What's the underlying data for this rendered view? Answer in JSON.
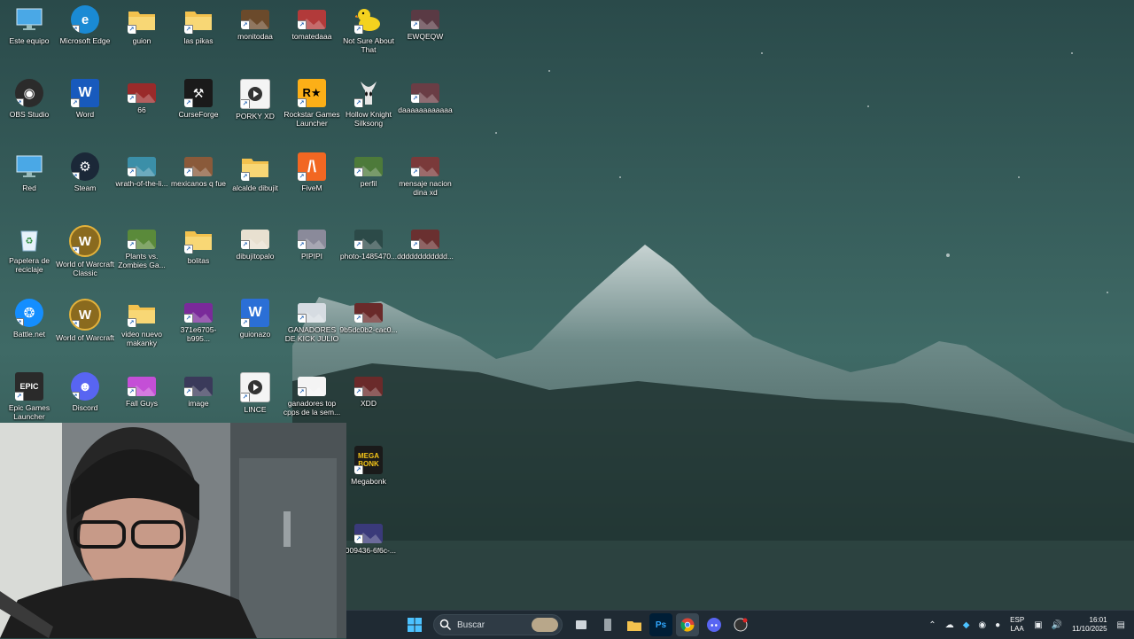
{
  "desktop": {
    "icons": [
      {
        "label": "Este equipo",
        "glyph": "monitor",
        "color": "#4aa8e6"
      },
      {
        "label": "Microsoft Edge",
        "glyph": "edge",
        "color": "#1a8ad4"
      },
      {
        "label": "guion",
        "glyph": "folder",
        "color": "#f3c24e"
      },
      {
        "label": "las pikas",
        "glyph": "folder",
        "color": "#f3c24e"
      },
      {
        "label": "monitodaa",
        "glyph": "photo",
        "color": "#6b4a2b"
      },
      {
        "label": "tomatedaaa",
        "glyph": "photo",
        "color": "#b23a3a"
      },
      {
        "label": "Not Sure About That",
        "glyph": "duck",
        "color": "#f4d21f"
      },
      {
        "label": "EWQEQW",
        "glyph": "photo",
        "color": "#5a3a44"
      },
      {
        "label": "OBS Studio",
        "glyph": "obs",
        "color": "#2b2b2b"
      },
      {
        "label": "Word",
        "glyph": "W",
        "color": "#185abd"
      },
      {
        "label": "66",
        "glyph": "photo",
        "color": "#9a2a2a"
      },
      {
        "label": "CurseForge",
        "glyph": "curse",
        "color": "#1a1a1a"
      },
      {
        "label": "PORKY XD",
        "glyph": "video",
        "color": "#f4f4f4"
      },
      {
        "label": "Rockstar Games Launcher",
        "glyph": "R★",
        "color": "#fcaf17"
      },
      {
        "label": "Hollow Knight Silksong",
        "glyph": "knight",
        "color": "#dcdcdc"
      },
      {
        "label": "daaaaaaaaaaaa",
        "glyph": "photo",
        "color": "#6a3d45"
      },
      {
        "label": "Red",
        "glyph": "network",
        "color": "#4aa8e6"
      },
      {
        "label": "Steam",
        "glyph": "steam",
        "color": "#1b2838"
      },
      {
        "label": "wrath-of-the-li...",
        "glyph": "photo",
        "color": "#3b8fa8"
      },
      {
        "label": "mexicanos q fue",
        "glyph": "photo",
        "color": "#8a5a3a"
      },
      {
        "label": "alcalde dibujit",
        "glyph": "folder",
        "color": "#f3c24e"
      },
      {
        "label": "FiveM",
        "glyph": "fivem",
        "color": "#f26722"
      },
      {
        "label": "perfil",
        "glyph": "photo",
        "color": "#4d7a3a"
      },
      {
        "label": "mensaje nacion dina xd",
        "glyph": "photo",
        "color": "#7a3a3a"
      },
      {
        "label": "Papelera de reciclaje",
        "glyph": "recycle",
        "color": "#e6f2fb"
      },
      {
        "label": "World of Warcraft Classic",
        "glyph": "wow",
        "color": "#8a6a1e"
      },
      {
        "label": "Plants vs. Zombies Ga...",
        "glyph": "photo",
        "color": "#5a8a3a"
      },
      {
        "label": "bolitas",
        "glyph": "folder",
        "color": "#f3c24e"
      },
      {
        "label": "dibujitopalo",
        "glyph": "photo",
        "color": "#e8e0d0"
      },
      {
        "label": "PIPIPI",
        "glyph": "photo",
        "color": "#8a8a9a"
      },
      {
        "label": "photo-1485470...",
        "glyph": "photo",
        "color": "#2c4a48"
      },
      {
        "label": "dddddddddddd...",
        "glyph": "photo",
        "color": "#6a3030"
      },
      {
        "label": "Battle.net",
        "glyph": "bnet",
        "color": "#148eff"
      },
      {
        "label": "World of Warcraft",
        "glyph": "wow",
        "color": "#8a6a1e"
      },
      {
        "label": "video nuevo makanky",
        "glyph": "folder",
        "color": "#f3c24e"
      },
      {
        "label": "371e6705-b995...",
        "glyph": "photo",
        "color": "#7a2a9a"
      },
      {
        "label": "guionazo",
        "glyph": "W",
        "color": "#2b6fd6"
      },
      {
        "label": "GANADORES DE KICK JULIO",
        "glyph": "photo",
        "color": "#d6dce2"
      },
      {
        "label": "9b5dc0b2-cac0...",
        "glyph": "photo",
        "color": "#6a2a2a"
      },
      {
        "label": "Epic Games Launcher",
        "glyph": "EPIC",
        "color": "#2a2a2a"
      },
      {
        "label": "Discord",
        "glyph": "discord",
        "color": "#5865f2"
      },
      {
        "label": "Fall Guys",
        "glyph": "photo",
        "color": "#c44fd6"
      },
      {
        "label": "image",
        "glyph": "photo",
        "color": "#3a3a5a"
      },
      {
        "label": "LINCE",
        "glyph": "video",
        "color": "#f4f4f4"
      },
      {
        "label": "ganadores top cpps de la sem...",
        "glyph": "photo",
        "color": "#f4f4f4"
      },
      {
        "label": "XDD",
        "glyph": "photo",
        "color": "#6a2a2a"
      },
      {
        "label": "Megabonk",
        "glyph": "MEGA BONK",
        "color": "#1a1a1a"
      },
      {
        "label": "5009436-6f6c-...",
        "glyph": "photo",
        "color": "#3a3a7a"
      }
    ]
  },
  "taskbar": {
    "search_placeholder": "Buscar",
    "apps": [
      "task-view",
      "terminal",
      "file-explorer",
      "Ps",
      "chrome",
      "discord",
      "obs"
    ],
    "tray": {
      "language_top": "ESP",
      "language_bottom": "LAA",
      "time": "16:01",
      "date": "11/10/2025"
    }
  }
}
